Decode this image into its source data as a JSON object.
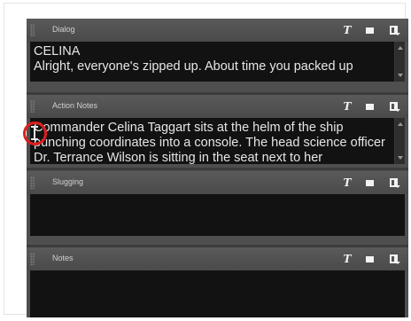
{
  "panels": [
    {
      "title": "Dialog",
      "text": "CELINA\nAlright, everyone's zipped up. About time you packed up"
    },
    {
      "title": "Action Notes",
      "text": "Commander Celina Taggart sits at the helm of the ship punching coordinates into a console. The head science officer Dr. Terrance Wilson is sitting in the seat next to her"
    },
    {
      "title": "Slugging",
      "text": ""
    },
    {
      "title": "Notes",
      "text": ""
    }
  ],
  "icons": {
    "text_tool": "T",
    "window_tool": "window-icon",
    "menu_tool": "panel-menu-icon"
  }
}
